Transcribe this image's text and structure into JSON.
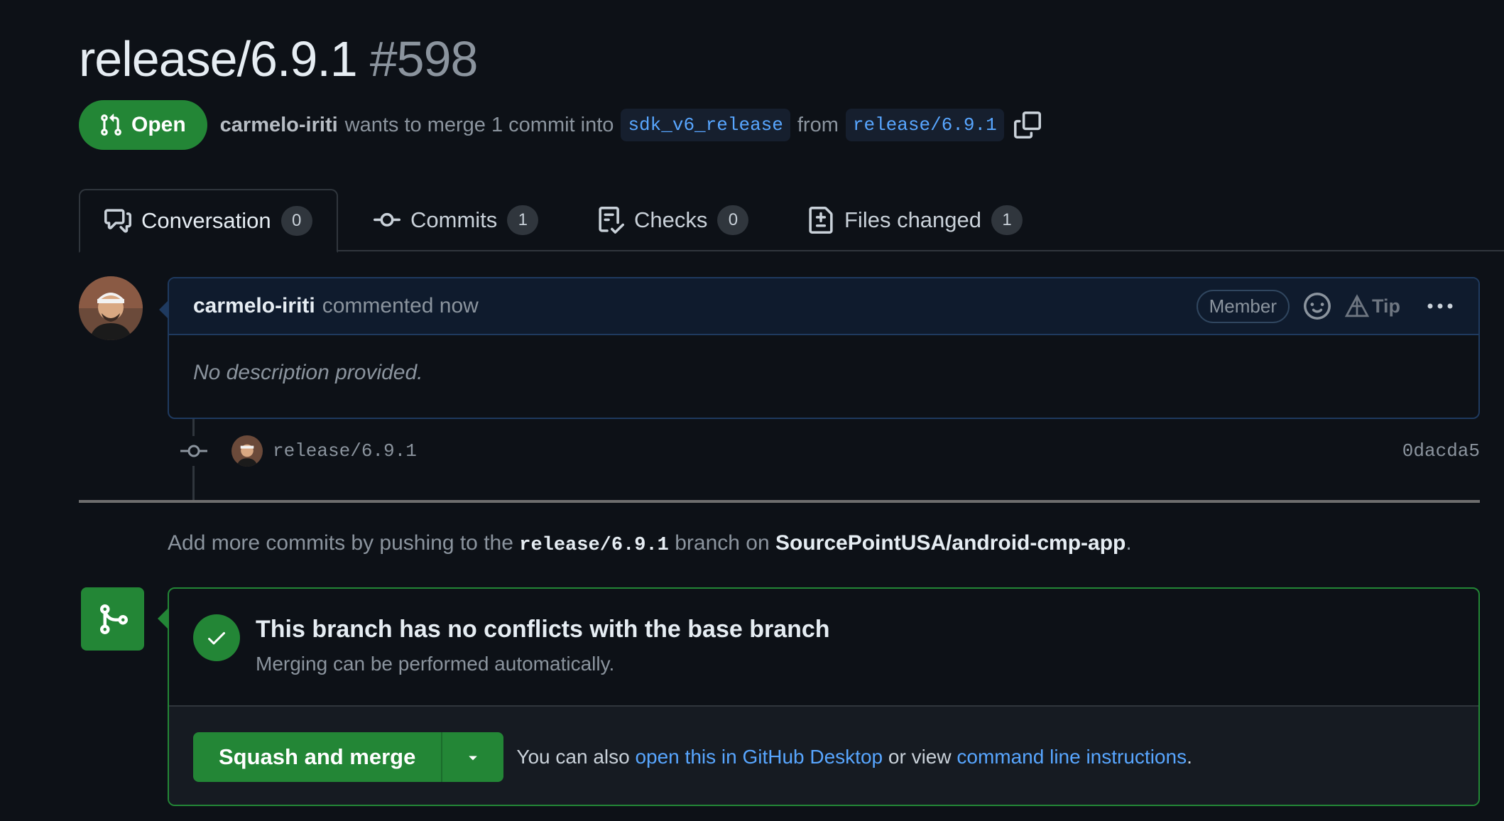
{
  "pr": {
    "title": "release/6.9.1",
    "number": "#598",
    "state": "Open",
    "author": "carmelo-iriti",
    "merge_text": "wants to merge 1 commit into",
    "base_branch": "sdk_v6_release",
    "from_text": "from",
    "head_branch": "release/6.9.1"
  },
  "tabs": [
    {
      "label": "Conversation",
      "count": "0",
      "icon": "comment-discussion-icon"
    },
    {
      "label": "Commits",
      "count": "1",
      "icon": "git-commit-icon"
    },
    {
      "label": "Checks",
      "count": "0",
      "icon": "checklist-icon"
    },
    {
      "label": "Files changed",
      "count": "1",
      "icon": "file-diff-icon"
    }
  ],
  "comment": {
    "author": "carmelo-iriti",
    "action": "commented now",
    "badge": "Member",
    "tip": "Tip",
    "body": "No description provided."
  },
  "commit": {
    "message": "release/6.9.1",
    "sha": "0dacda5"
  },
  "hint": {
    "prefix": "Add more commits by pushing to the",
    "branch": "release/6.9.1",
    "middle": "branch on",
    "repo": "SourcePointUSA/android-cmp-app",
    "suffix": "."
  },
  "merge": {
    "status_title": "This branch has no conflicts with the base branch",
    "status_sub": "Merging can be performed automatically.",
    "button_label": "Squash and merge",
    "alt_prefix": "You can also",
    "alt_link1": "open this in GitHub Desktop",
    "alt_middle": "or view",
    "alt_link2": "command line instructions",
    "alt_suffix": "."
  },
  "colors": {
    "background": "#0d1117",
    "accent_green": "#238636",
    "link_blue": "#58a6ff",
    "muted": "#8b949e"
  }
}
